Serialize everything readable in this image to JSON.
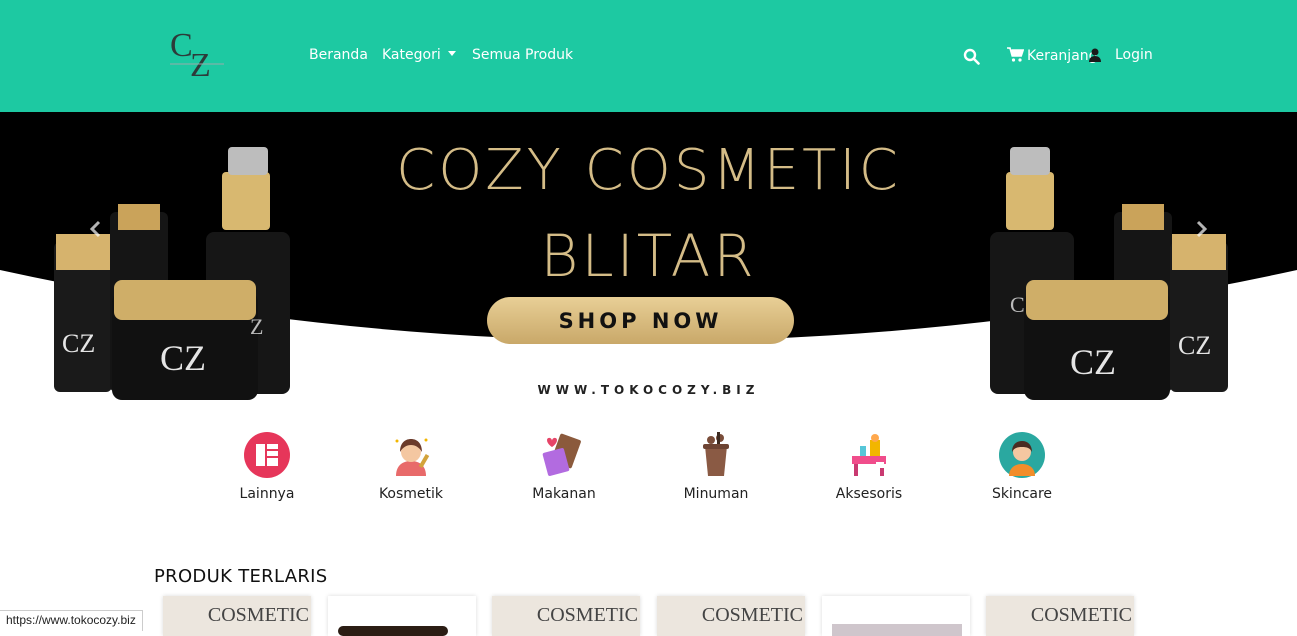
{
  "nav": {
    "logo_alt": "CZ",
    "links": {
      "beranda": "Beranda",
      "kategori": "Kategori",
      "semua_produk": "Semua Produk"
    },
    "cart_label": "Keranjang",
    "login_label": "Login",
    "icons": [
      "search-icon",
      "cart-icon",
      "user-icon"
    ],
    "bg_color": "#1dc9a2"
  },
  "hero": {
    "title_line1": "COZY COSMETIC",
    "title_line2": "BLITAR",
    "button_label": "SHOP NOW",
    "website": "WWW.TOKOCOZY.BIZ",
    "prev_icon": "chevron-left-icon",
    "next_icon": "chevron-right-icon"
  },
  "categories": [
    {
      "label": "Lainnya",
      "icon": "grid-list-icon"
    },
    {
      "label": "Kosmetik",
      "icon": "makeup-woman-icon"
    },
    {
      "label": "Makanan",
      "icon": "chocolate-icon"
    },
    {
      "label": "Minuman",
      "icon": "drink-cup-icon"
    },
    {
      "label": "Aksesoris",
      "icon": "vanity-table-icon"
    },
    {
      "label": "Skincare",
      "icon": "woman-avatar-icon"
    }
  ],
  "bestsellers": {
    "title": "PRODUK TERLARIS",
    "products": [
      {
        "text": "COSMETIC"
      },
      {
        "text": ""
      },
      {
        "text": "COSMETIC"
      },
      {
        "text": "COSMETIC"
      },
      {
        "text": ""
      },
      {
        "text": "COSMETIC"
      }
    ]
  },
  "status_bar": {
    "url": "https://www.tokocozy.biz"
  }
}
